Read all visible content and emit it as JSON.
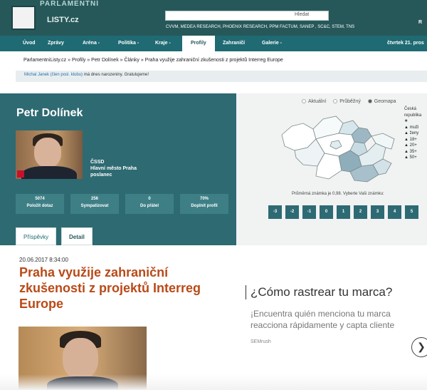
{
  "header": {
    "logo_top": "PARLAMENTNÍ",
    "logo_sub": "LISTY.cz",
    "search_label": "Hledat",
    "partners": "CVVM, MEDEA RESEARCH, PHOENIX RESEARCH, PPM FACTUM, SANEP , SC&C, STEM, TNS",
    "right_partial": "R"
  },
  "menu": {
    "items": [
      {
        "label": "Úvod"
      },
      {
        "label": "Zprávy"
      },
      {
        "label": "Aréna -"
      },
      {
        "label": "Politika -"
      },
      {
        "label": "Kraje -"
      },
      {
        "label": "Profily"
      },
      {
        "label": "Zahraničí"
      },
      {
        "label": "Galerie -"
      }
    ],
    "date": "čtvrtek 21. pros"
  },
  "breadcrumb": "ParlamentniListy.cz » Profily » Petr Dolínek » Články » Praha využije zahraniční zkušenosti z projektů Interreg Europe",
  "ticker": {
    "name": "Michal Janek (člen posl. klubu)",
    "text": " má dnes narozeniny. Gratulujeme!"
  },
  "profile": {
    "name": "Petr Dolínek",
    "party": "ČSSD",
    "region": "Hlavní město Praha",
    "role": "poslanec",
    "stats": [
      {
        "value": "5074",
        "label": "Položit dotaz"
      },
      {
        "value": "256",
        "label": "Sympatizovat"
      },
      {
        "value": "0",
        "label": "Do přátel"
      },
      {
        "value": "70%",
        "label": "Doplnit profil"
      }
    ],
    "tabs": [
      "Příspěvky",
      "Detail"
    ]
  },
  "map": {
    "filters": [
      "Aktuální",
      "Průběžný",
      "Geomapa"
    ],
    "legend": [
      "Česká",
      "republika",
      "★",
      "▲ muži",
      "▲ ženy",
      "▲ 18+",
      "▲ 20+",
      "▲ 35+",
      "▲ 50+"
    ],
    "average_text": "Průměrná známka je 0,98. Vyberte Vaši známku:",
    "ratings": [
      "-3",
      "-2",
      "-1",
      "0",
      "1",
      "2",
      "3",
      "4",
      "5"
    ]
  },
  "article": {
    "date": "20.06.2017 8:34:00",
    "title": "Praha využije zahraniční zkušenosti z projektů Interreg Europe"
  },
  "ad": {
    "title": "¿Cómo rastrear tu marca?",
    "text_line1": "¡Encuentra quién menciona tu marca",
    "text_line2": "reacciona rápidamente y capta cliente",
    "source": "SEMrush",
    "button_icon": "chevron-right-icon"
  }
}
